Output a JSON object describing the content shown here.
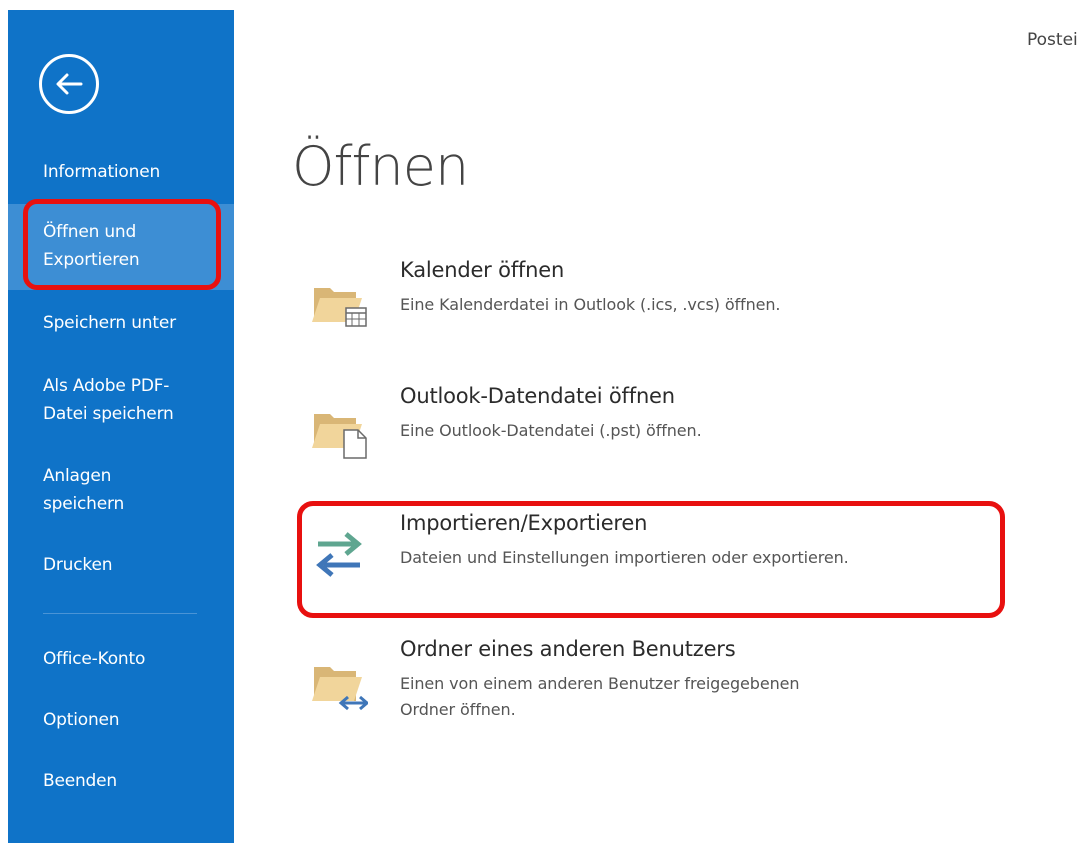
{
  "header": {
    "top_right_text": "Postei"
  },
  "sidebar": {
    "back_label": "Zurück",
    "items": [
      {
        "label": "Informationen",
        "active": false
      },
      {
        "label": "Öffnen und\nExportieren",
        "active": true
      },
      {
        "label": "Speichern unter",
        "active": false
      },
      {
        "label": "Als Adobe PDF-\nDatei speichern",
        "active": false
      },
      {
        "label": "Anlagen\nspeichern",
        "active": false
      },
      {
        "label": "Drucken",
        "active": false
      },
      {
        "label": "Office-Konto",
        "active": false
      },
      {
        "label": "Optionen",
        "active": false
      },
      {
        "label": "Beenden",
        "active": false
      }
    ]
  },
  "main": {
    "title": "Öffnen",
    "options": [
      {
        "title": "Kalender öffnen",
        "description": "Eine Kalenderdatei in Outlook (.ics, .vcs) öffnen.",
        "icon": "folder-calendar-icon"
      },
      {
        "title": "Outlook-Datendatei öffnen",
        "description": "Eine Outlook-Datendatei (.pst) öffnen.",
        "icon": "folder-file-icon"
      },
      {
        "title": "Importieren/Exportieren",
        "description": "Dateien und Einstellungen importieren oder exportieren.",
        "icon": "import-export-arrows-icon"
      },
      {
        "title": "Ordner eines anderen Benutzers",
        "description": "Einen von einem anderen Benutzer freigegebenen\nOrdner öffnen.",
        "icon": "folder-shared-icon"
      }
    ]
  },
  "colors": {
    "sidebar_bg": "#0f73c8",
    "sidebar_active_bg": "#3d8ed4",
    "highlight_red": "#e8100f",
    "arrow_green": "#5fa690",
    "arrow_blue": "#3f76b8",
    "folder_tan": "#e9c98d"
  }
}
